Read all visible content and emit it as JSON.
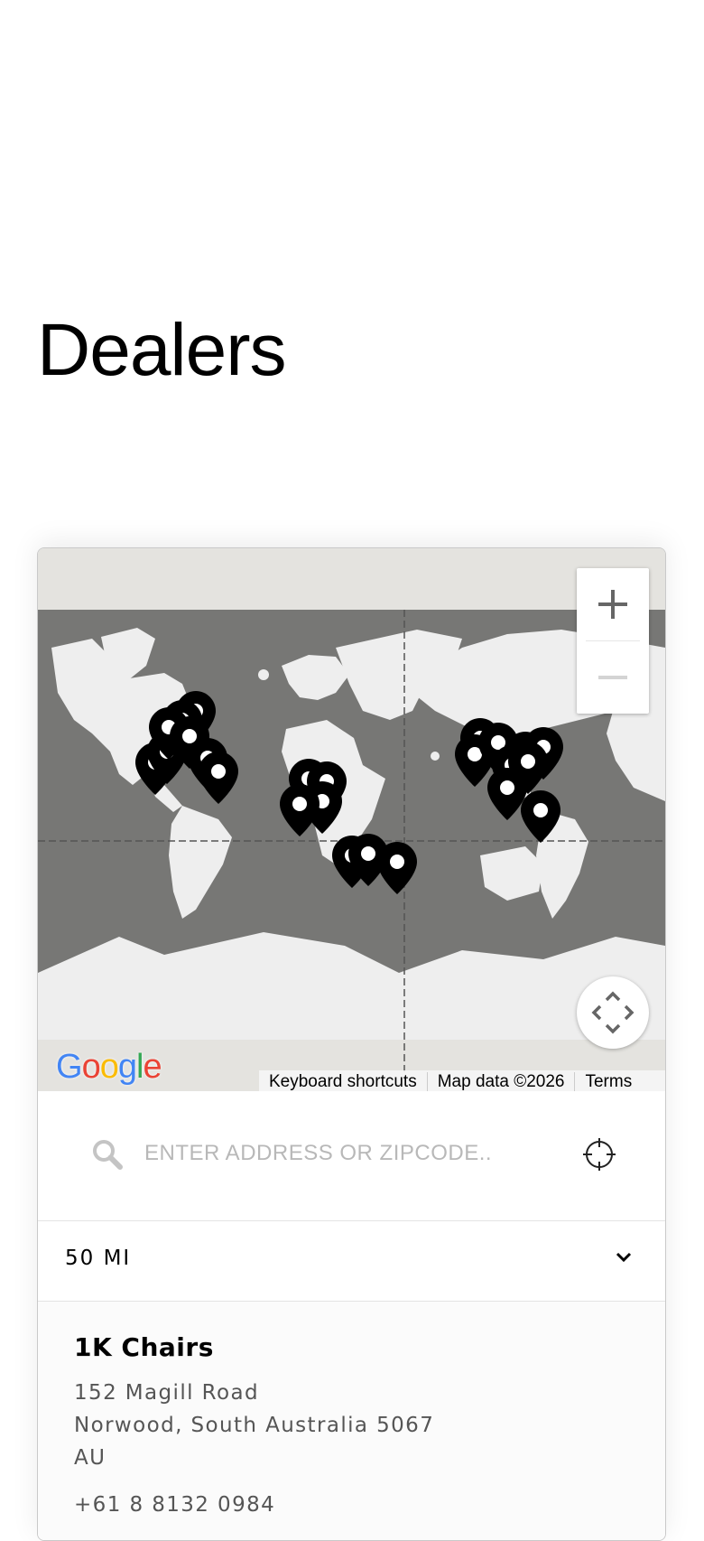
{
  "page": {
    "title": "Dealers"
  },
  "map": {
    "zoom_in_label": "+",
    "zoom_out_label": "−",
    "google_logo": [
      "G",
      "o",
      "o",
      "g",
      "l",
      "e"
    ],
    "google_logo_colors": [
      "#4285F4",
      "#EA4335",
      "#FBBC05",
      "#4285F4",
      "#34A853",
      "#EA4335"
    ],
    "attribution": {
      "shortcuts": "Keyboard shortcuts",
      "map_data": "Map data ©2026",
      "terms": "Terms"
    },
    "colors": {
      "ocean": "#777775",
      "land": "#eeeeee",
      "pin": "#000000",
      "band": "#e4e3df"
    }
  },
  "search": {
    "placeholder": "ENTER ADDRESS OR ZIPCODE..",
    "value": ""
  },
  "radius": {
    "selected": "50 MI"
  },
  "dealers": [
    {
      "name": "1K Chairs",
      "address_line1": "152 Magill Road",
      "address_line2": "Norwood, South Australia 5067",
      "country": "AU",
      "phone": "+61 8 8132 0984"
    }
  ]
}
